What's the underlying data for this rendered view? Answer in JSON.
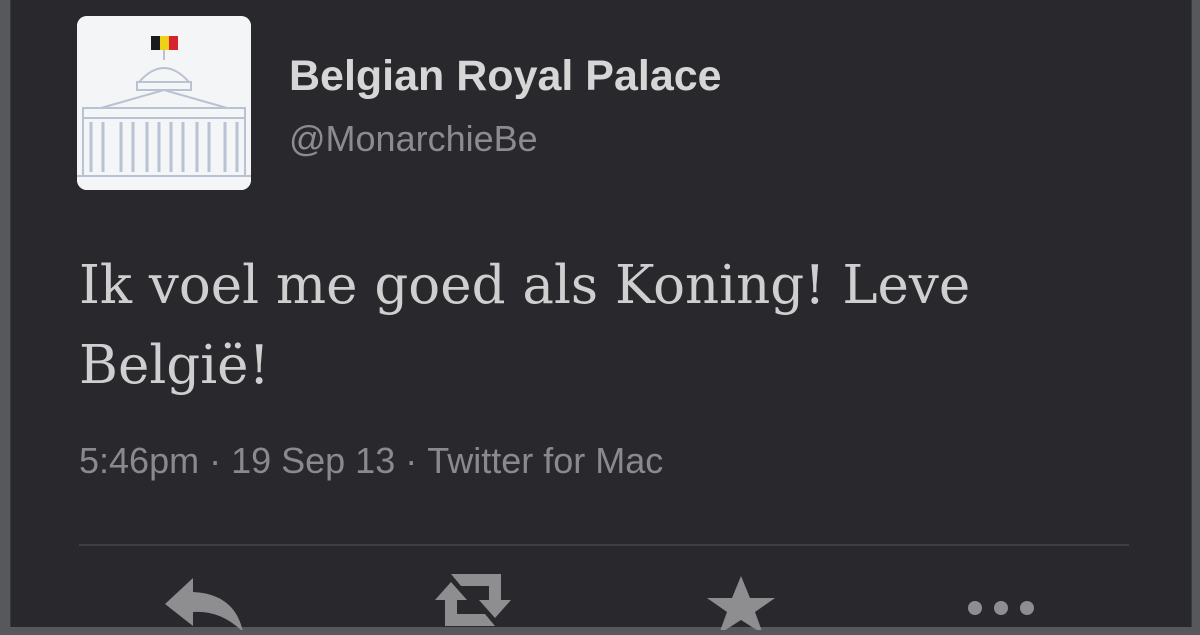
{
  "tweet": {
    "author_name": "Belgian Royal Palace",
    "handle": "@MonarchieBe",
    "text_line1": "Ik voel me goed als Koning! Leve",
    "text_line2": "België!",
    "time": "5:46pm",
    "date": "19 Sep 13",
    "source": "Twitter for Mac",
    "separator": " · "
  },
  "avatar": {
    "icon": "royal-palace-logo",
    "flag_colors": [
      "#1a1a1a",
      "#f1d117",
      "#d8232a"
    ]
  },
  "actions": [
    {
      "name": "reply",
      "icon": "reply-icon"
    },
    {
      "name": "retweet",
      "icon": "retweet-icon"
    },
    {
      "name": "favorite",
      "icon": "star-icon"
    },
    {
      "name": "more",
      "icon": "more-icon"
    }
  ],
  "colors": {
    "background": "#29292d",
    "name_text": "#d6d6d6",
    "secondary_text": "#8c8c8f",
    "icon": "#8e8e91"
  }
}
